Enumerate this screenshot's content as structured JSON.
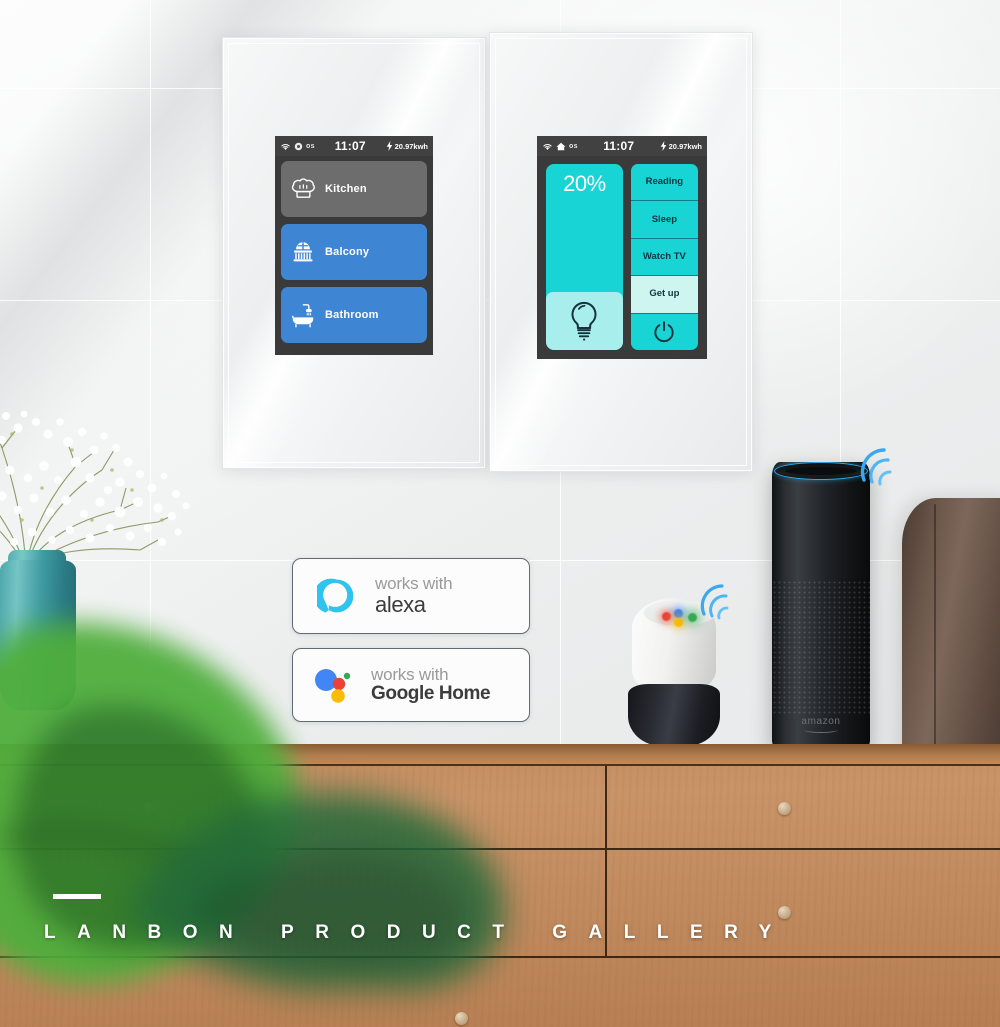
{
  "scene": {
    "title": "Lanbon smart switch panel product gallery",
    "colors": {
      "accent_blue": "#3E86D4",
      "accent_cyan": "#18D4D4",
      "accent_mint": "#CFF5F0",
      "screen_bg": "#3A3A3A",
      "statusbar_bg": "#414141",
      "inactive_gray": "#6D6D6D",
      "wood": "#C08A5D",
      "vase_teal": "#3F9BA2"
    }
  },
  "left_panel": {
    "name": "Room control panel",
    "statusbar": {
      "wifi_icon": "wifi-icon",
      "mode_icon": "moon-icon",
      "mode_label": "os",
      "time": "11:07",
      "energy_icon": "bolt-icon",
      "energy": "20.97kwh"
    },
    "rooms": [
      {
        "label": "Kitchen",
        "icon": "chef-hat-icon",
        "state": "inactive"
      },
      {
        "label": "Balcony",
        "icon": "balcony-icon",
        "state": "active"
      },
      {
        "label": "Bathroom",
        "icon": "bathtub-icon",
        "state": "active"
      }
    ]
  },
  "right_panel": {
    "name": "Lighting and scene panel",
    "statusbar": {
      "wifi_icon": "wifi-icon",
      "mode_icon": "home-icon",
      "mode_label": "os",
      "time": "11:07",
      "energy_icon": "bolt-icon",
      "energy": "20.97kwh"
    },
    "dimmer": {
      "value_label": "20%",
      "value": 20,
      "bulb_icon": "lightbulb-icon"
    },
    "scenes": [
      {
        "label": "Reading",
        "state": "normal"
      },
      {
        "label": "Sleep",
        "state": "normal"
      },
      {
        "label": "Watch TV",
        "state": "normal"
      },
      {
        "label": "Get up",
        "state": "selected"
      }
    ],
    "power_icon": "power-icon"
  },
  "badges": [
    {
      "id": "alexa",
      "icon": "alexa-ring-icon",
      "works_with": "works with",
      "brand": "alexa"
    },
    {
      "id": "google-home",
      "icon": "google-assistant-icon",
      "works_with": "works with",
      "brand": "Google Home"
    }
  ],
  "devices": {
    "echo": {
      "name": "Amazon Echo speaker",
      "logo": "amazon"
    },
    "google_home": {
      "name": "Google Home speaker"
    }
  },
  "caption": {
    "title": "L A N B O N  P R O D U C T  G A L L E R Y",
    "plain": "LANBON PRODUCT GALLERY"
  }
}
